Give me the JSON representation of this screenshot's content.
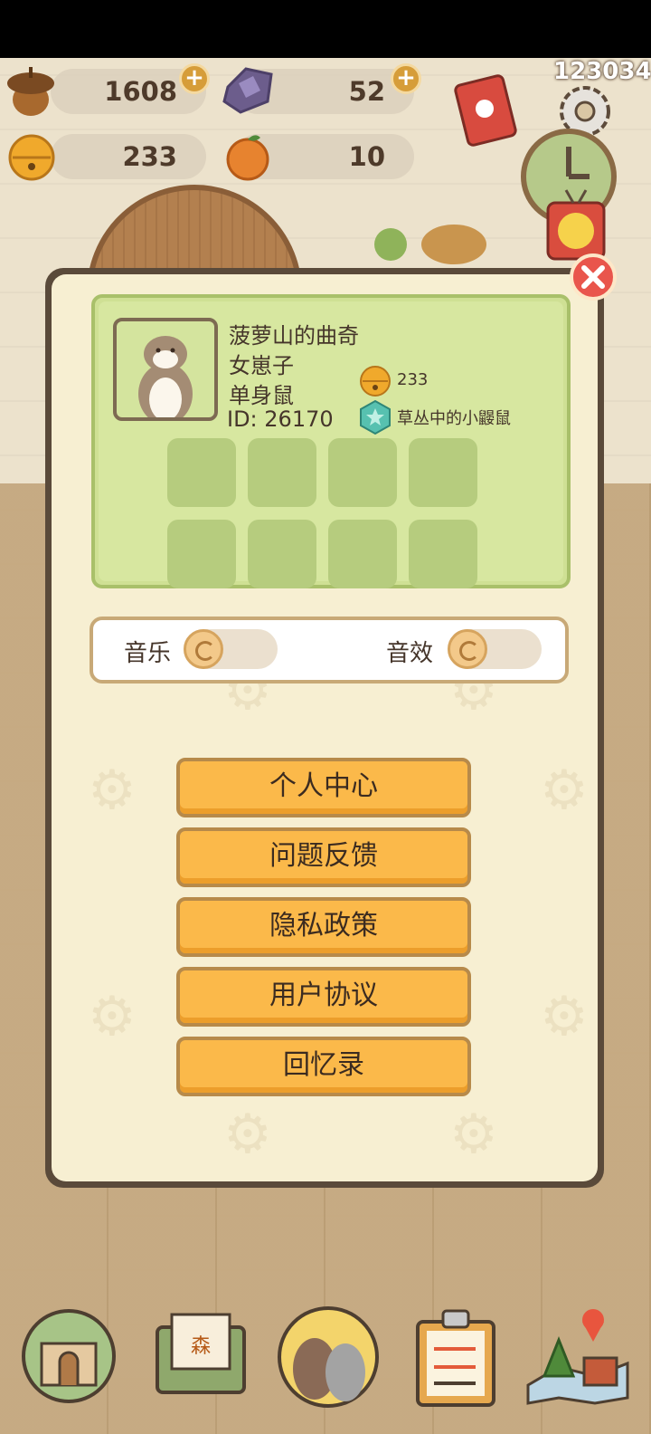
{
  "header": {
    "score": "123034",
    "resources": [
      {
        "name": "acorn",
        "value": "1608",
        "has_plus": true
      },
      {
        "name": "crystal",
        "value": "52",
        "has_plus": true
      },
      {
        "name": "bell",
        "value": "233",
        "has_plus": false
      },
      {
        "name": "orange",
        "value": "10",
        "has_plus": false
      }
    ]
  },
  "profile": {
    "name": "菠萝山的曲奇",
    "gender": "女崽子",
    "status": "单身鼠",
    "id": "ID: 26170",
    "bells": "233",
    "title": "草丛中的小鼹鼠"
  },
  "settings": {
    "music_label": "音乐",
    "sfx_label": "音效"
  },
  "menu": [
    "个人中心",
    "问题反馈",
    "隐私政策",
    "用户协议",
    "回忆录"
  ],
  "colors": {
    "button": "#fbb94a",
    "panel": "#f7efd2",
    "card": "#d7e7a0",
    "close": "#e9554c"
  }
}
